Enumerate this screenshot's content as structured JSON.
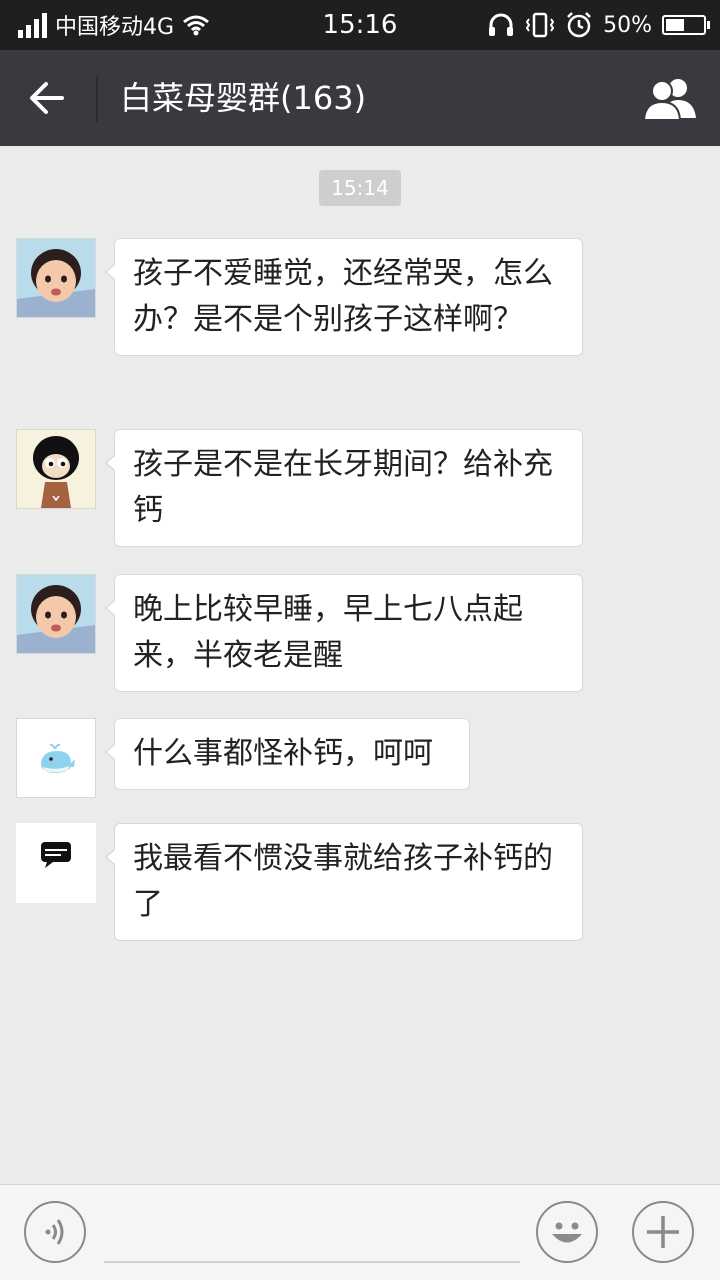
{
  "status_bar": {
    "carrier": "中国移动4G",
    "time": "15:16",
    "battery_percent_text": "50%",
    "battery_level": 0.5,
    "icons": [
      "signal-icon",
      "wifi-icon",
      "headphones-icon",
      "vibrate-icon",
      "alarm-icon",
      "battery-icon"
    ]
  },
  "header": {
    "back_icon": "back-arrow-icon",
    "title": "白菜母婴群(163)",
    "members_icon": "group-members-icon"
  },
  "chat": {
    "timestamp": "15:14",
    "messages": [
      {
        "avatar": "baby-girl-avatar",
        "text": "孩子不爱睡觉，还经常哭，怎么办？是不是个别孩子这样啊？"
      },
      {
        "avatar": "cartoon-girl-avatar",
        "text": "孩子是不是在长牙期间？给补充钙"
      },
      {
        "avatar": "baby-girl-avatar",
        "text": "晚上比较早睡，早上七八点起来，半夜老是醒"
      },
      {
        "avatar": "whale-avatar",
        "text": "什么事都怪补钙，呵呵"
      },
      {
        "avatar": "speech-bubble-avatar",
        "text": "我最看不惯没事就给孩子补钙的了"
      }
    ]
  },
  "input_bar": {
    "voice_icon": "voice-icon",
    "input_value": "",
    "emoji_icon": "emoji-icon",
    "plus_icon": "plus-icon"
  },
  "colors": {
    "header_bg": "#393a3f",
    "status_bg": "#1f1f1f",
    "chat_bg": "#ebebeb",
    "bubble_bg": "#ffffff"
  }
}
